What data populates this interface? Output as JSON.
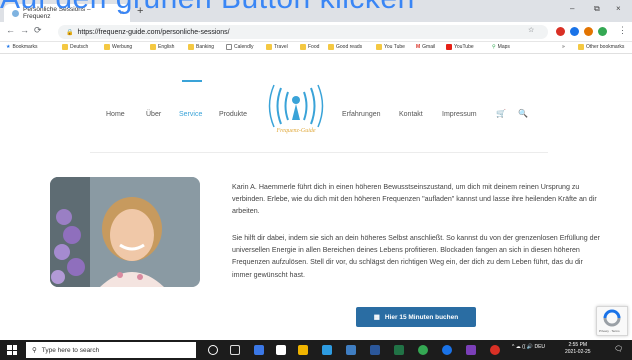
{
  "overlay": {
    "caption": "Auf den grünen Button klicken"
  },
  "browser": {
    "tab_title": "Persönliche Sessions – Frequenz",
    "tab_close": "×",
    "new_tab": "+",
    "url": "https://frequenz-guide.com/personliche-sessions/",
    "window_minimize": "–",
    "window_restore": "⧉",
    "window_close": "×"
  },
  "bookmarks": [
    {
      "label": "Bookmarks"
    },
    {
      "label": "Deutsch"
    },
    {
      "label": "Werbung"
    },
    {
      "label": "English"
    },
    {
      "label": "Banking"
    },
    {
      "label": "Calendly"
    },
    {
      "label": "Travel"
    },
    {
      "label": "Food"
    },
    {
      "label": "Good reads"
    },
    {
      "label": "You Tube"
    },
    {
      "label": "Gmail"
    },
    {
      "label": "YouTube"
    },
    {
      "label": "Maps"
    },
    {
      "label": "»"
    },
    {
      "label": "Other bookmarks"
    }
  ],
  "nav": {
    "home": "Home",
    "ueber": "Über",
    "service": "Service",
    "produkte": "Produkte",
    "erfahrungen": "Erfahrungen",
    "kontakt": "Kontakt",
    "impressum": "Impressum"
  },
  "logo": {
    "text": "Frequenz-Guide"
  },
  "content": {
    "paragraph1": "Karin A. Haemmerle führt dich in einen höheren Bewusstseinszustand, um dich mit deinem reinen Ursprung zu verbinden. Erlebe, wie du dich mit den höheren Frequenzen \"aufladen\" kannst und lasse ihre heilenden Kräfte an dir arbeiten.",
    "paragraph2": "Sie hilft dir dabei, indem sie sich an dein höheres Selbst anschließt. So kannst du von der grenzenlosen Erfüllung der universellen Energie in allen Bereichen deines Lebens profitieren. Blockaden fangen an sich in diesen höheren Frequenzen aufzulösen. Stell dir vor, du schlägst den richtigen Weg ein, der dich zu dem Leben führt, das du dir immer gewünscht hast.",
    "cta_label": "Hier 15 Minuten buchen"
  },
  "recaptcha": {
    "label": "Privacy · Terms"
  },
  "taskbar": {
    "search_placeholder": "Type here to search",
    "tray_text": "^ ☁ ((  🔊 DEU",
    "time": "2:55 PM",
    "date": "2021-02-25"
  },
  "colors": {
    "accent": "#3aa3d8",
    "cta": "#2a6da3",
    "caption": "#3a86f5"
  }
}
